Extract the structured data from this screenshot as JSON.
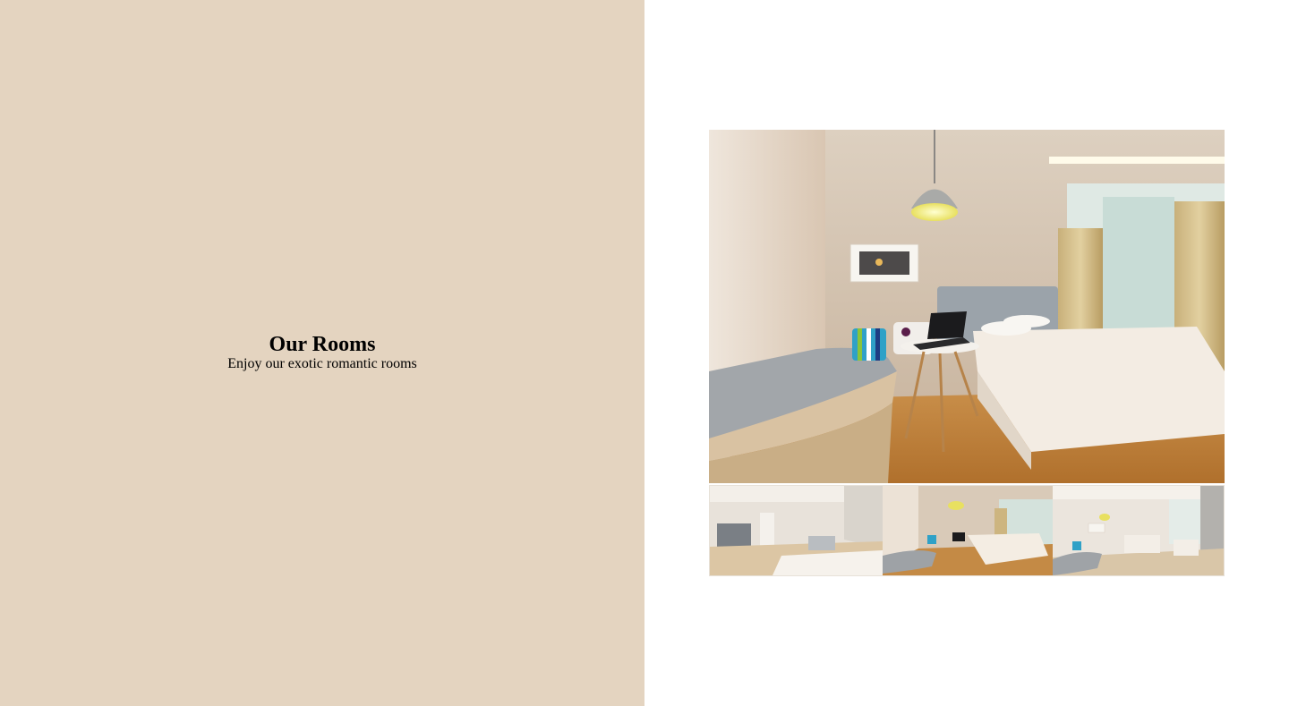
{
  "section": {
    "title": "Our Rooms",
    "subtitle": "Enjoy our exotic romantic rooms"
  },
  "colors": {
    "left_panel_bg": "#e4d4c0",
    "page_bg": "#ffffff"
  },
  "gallery": {
    "main_image": "hotel-room-photo",
    "thumbnails": [
      "hotel-room-thumbnail-1",
      "hotel-room-thumbnail-2",
      "hotel-room-thumbnail-3"
    ]
  }
}
